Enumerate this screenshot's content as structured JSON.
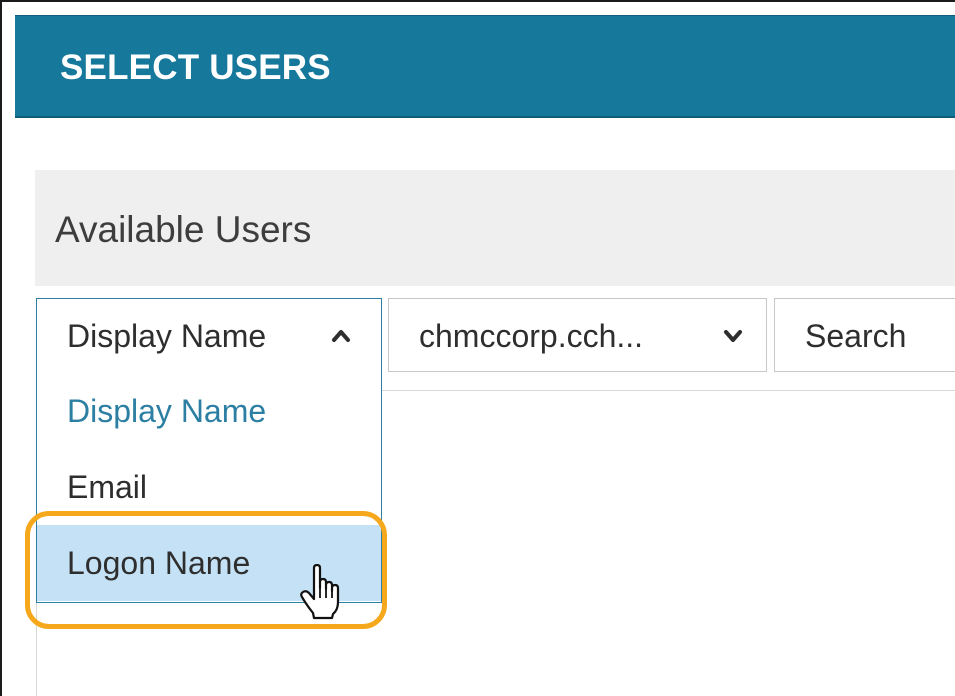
{
  "header": {
    "title": "SELECT USERS"
  },
  "section": {
    "title": "Available Users"
  },
  "filters": {
    "sort_by": {
      "value": "Display Name",
      "expanded": true,
      "options": [
        {
          "label": "Display Name",
          "selected": true
        },
        {
          "label": "Email",
          "selected": false
        },
        {
          "label": "Logon Name",
          "selected": false,
          "hovered": true
        }
      ]
    },
    "domain": {
      "value": "chmccorp.cch..."
    },
    "search": {
      "placeholder": "Search"
    }
  },
  "colors": {
    "header_bg": "#16799c",
    "accent": "#2c7fa3",
    "hover_bg": "#c4e1f5",
    "highlight_ring": "#f5a81c",
    "section_bg": "#efefef"
  },
  "icons": {
    "sort_toggle": "chevron-up-icon",
    "domain_toggle": "chevron-down-icon",
    "pointer": "hand-pointer-icon"
  }
}
